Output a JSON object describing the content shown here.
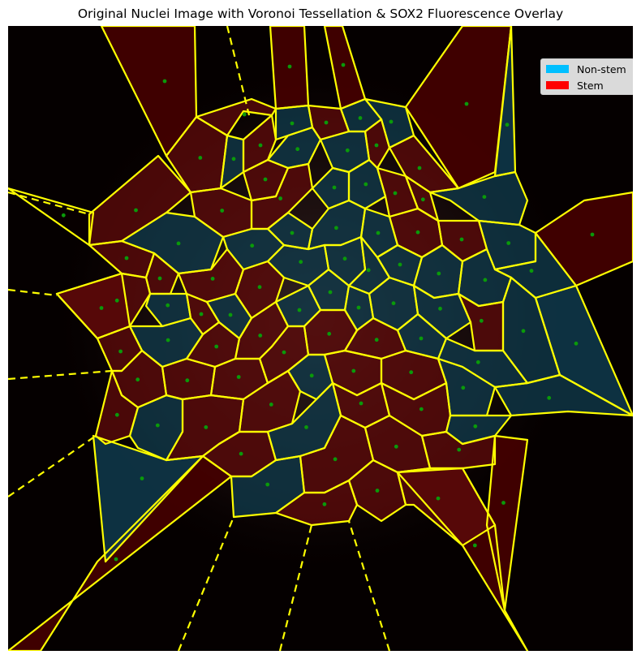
{
  "title": "Original Nuclei Image with Voronoi Tessellation & SOX2 Fluorescence Overlay",
  "legend": {
    "items": [
      {
        "label": "Non-stem",
        "color": "#00bfff"
      },
      {
        "label": "Stem",
        "color": "#ff0000"
      }
    ]
  },
  "colors": {
    "edge": "#ffff00",
    "nucleus_point": "#00a000",
    "stem_fill": "#8b0000",
    "non_stem_fill": "#0f4a5e",
    "background": "#050000"
  }
}
